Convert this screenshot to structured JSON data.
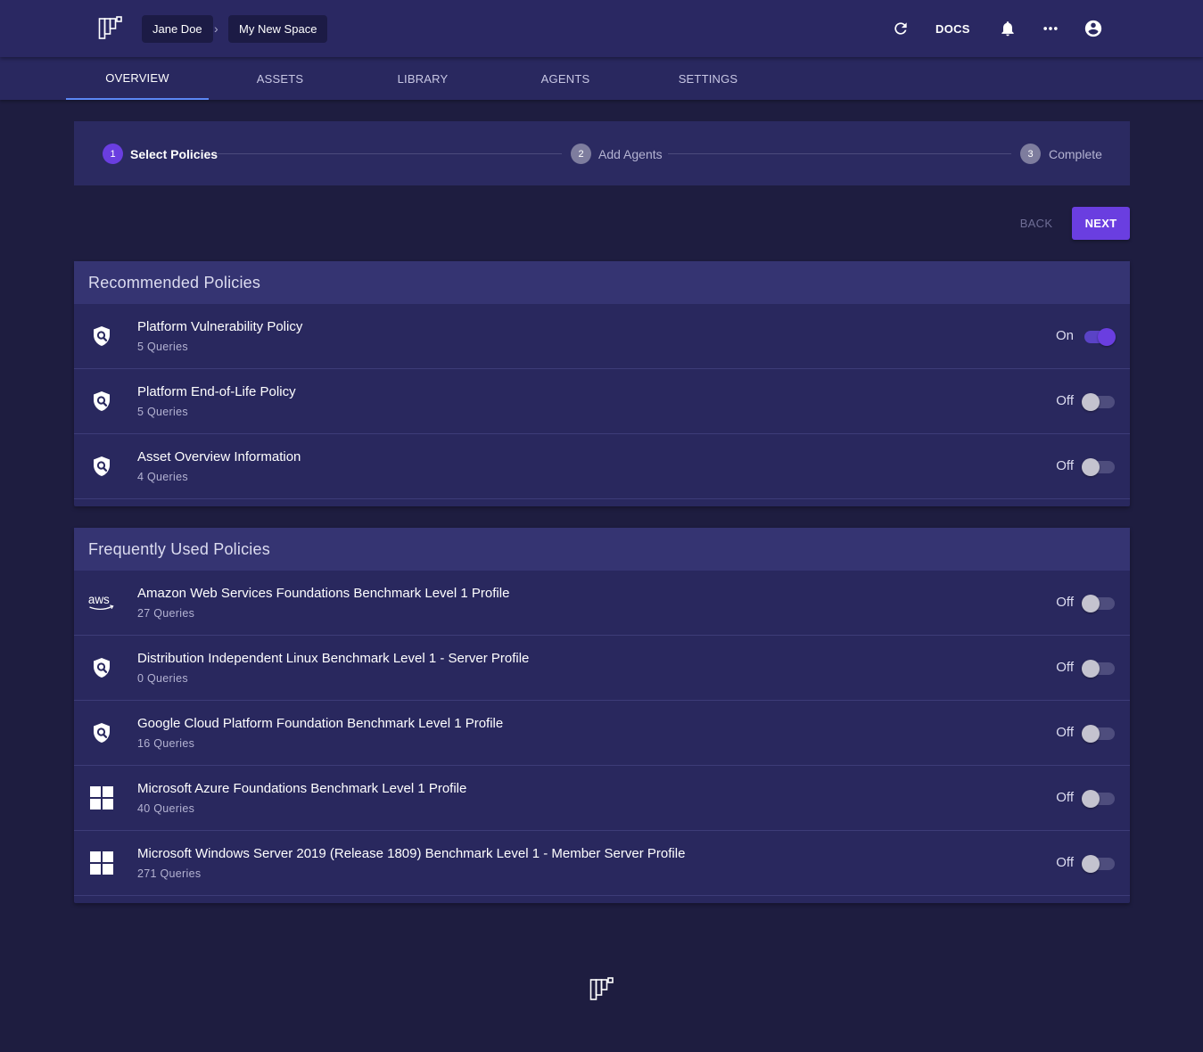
{
  "header": {
    "breadcrumb": [
      "Jane Doe",
      "My New Space"
    ],
    "breadcrumb_separator": "›",
    "docs_label": "DOCS",
    "icons": [
      "refresh-icon",
      "bell-icon",
      "more-horizontal-icon",
      "account-circle-icon"
    ]
  },
  "tabs": [
    {
      "label": "OVERVIEW",
      "active": true
    },
    {
      "label": "ASSETS",
      "active": false
    },
    {
      "label": "LIBRARY",
      "active": false
    },
    {
      "label": "AGENTS",
      "active": false
    },
    {
      "label": "SETTINGS",
      "active": false
    }
  ],
  "stepper": {
    "steps": [
      {
        "number": "1",
        "label": "Select Policies",
        "active": true
      },
      {
        "number": "2",
        "label": "Add Agents",
        "active": false
      },
      {
        "number": "3",
        "label": "Complete",
        "active": false
      }
    ]
  },
  "actions": {
    "back_label": "BACK",
    "next_label": "NEXT"
  },
  "recommended": {
    "title": "Recommended Policies",
    "items": [
      {
        "icon": "shield-search-icon",
        "title": "Platform Vulnerability Policy",
        "queries": "5 Queries",
        "state": "On"
      },
      {
        "icon": "shield-search-icon",
        "title": "Platform End-of-Life Policy",
        "queries": "5 Queries",
        "state": "Off"
      },
      {
        "icon": "shield-search-icon",
        "title": "Asset Overview Information",
        "queries": "4 Queries",
        "state": "Off"
      }
    ]
  },
  "frequent": {
    "title": "Frequently Used Policies",
    "items": [
      {
        "icon": "aws-logo-icon",
        "title": "Amazon Web Services Foundations Benchmark Level 1 Profile",
        "queries": "27 Queries",
        "state": "Off"
      },
      {
        "icon": "shield-search-icon",
        "title": "Distribution Independent Linux Benchmark Level 1 - Server Profile",
        "queries": "0 Queries",
        "state": "Off"
      },
      {
        "icon": "shield-search-icon",
        "title": "Google Cloud Platform Foundation Benchmark Level 1 Profile",
        "queries": "16 Queries",
        "state": "Off"
      },
      {
        "icon": "windows-logo-icon",
        "title": "Microsoft Azure Foundations Benchmark Level 1 Profile",
        "queries": "40 Queries",
        "state": "Off"
      },
      {
        "icon": "windows-logo-icon",
        "title": "Microsoft Windows Server 2019 (Release 1809) Benchmark Level 1 - Member Server Profile",
        "queries": "271 Queries",
        "state": "Off"
      }
    ]
  },
  "colors": {
    "background": "#1e1d40",
    "topbar": "#2a2862",
    "accent": "#6a3ee0",
    "tab_indicator": "#5b87f5"
  }
}
